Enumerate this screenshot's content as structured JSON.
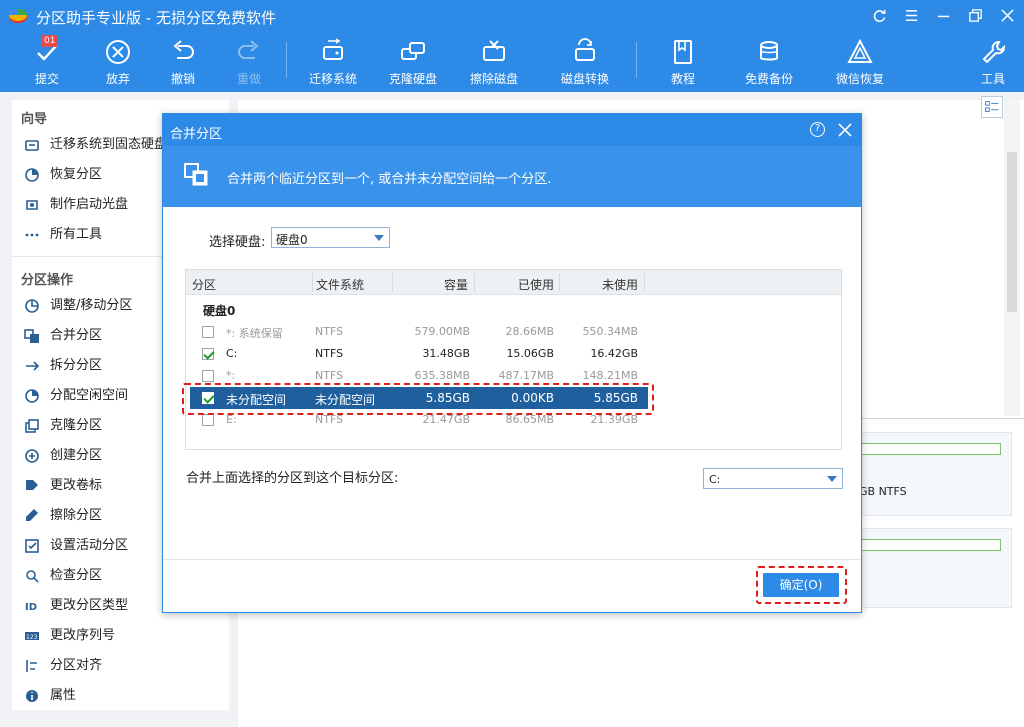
{
  "app": {
    "title": "分区助手专业版 - 无损分区免费软件"
  },
  "toolbar": {
    "badge": "01",
    "submit": "提交",
    "discard": "放弃",
    "undo": "撤销",
    "redo": "重做",
    "migrate": "迁移系统",
    "clone": "克隆硬盘",
    "wipe": "擦除磁盘",
    "convert": "磁盘转换",
    "tutorial": "教程",
    "backup": "免费备份",
    "wechat": "微信恢复",
    "tools": "工具"
  },
  "sidebar": {
    "wizard_title": "向导",
    "wizard_items": [
      {
        "label": "迁移系统到固态硬盘",
        "icon": "migrate-os-icon"
      },
      {
        "label": "恢复分区",
        "icon": "recover-partition-icon"
      },
      {
        "label": "制作启动光盘",
        "icon": "bootable-media-icon"
      },
      {
        "label": "所有工具",
        "icon": "more-dots-icon"
      }
    ],
    "ops_title": "分区操作",
    "ops_items": [
      {
        "label": "调整/移动分区",
        "icon": "resize-partition-icon"
      },
      {
        "label": "合并分区",
        "icon": "merge-partition-icon"
      },
      {
        "label": "拆分分区",
        "icon": "split-partition-icon"
      },
      {
        "label": "分配空闲空间",
        "icon": "allocate-space-icon"
      },
      {
        "label": "克隆分区",
        "icon": "clone-partition-icon"
      },
      {
        "label": "创建分区",
        "icon": "create-partition-icon"
      },
      {
        "label": "更改卷标",
        "icon": "tag-icon"
      },
      {
        "label": "擦除分区",
        "icon": "wipe-partition-icon"
      },
      {
        "label": "设置活动分区",
        "icon": "set-active-icon"
      },
      {
        "label": "检查分区",
        "icon": "check-partition-icon"
      },
      {
        "label": "更改分区类型",
        "icon": "id-icon"
      },
      {
        "label": "更改序列号",
        "icon": "serial-icon"
      },
      {
        "label": "分区对齐",
        "icon": "align-icon"
      },
      {
        "label": "属性",
        "icon": "info-icon"
      }
    ]
  },
  "background": {
    "fs_text": "GB NTFS"
  },
  "dialog": {
    "title": "合并分区",
    "help": "?",
    "banner": "合并两个临近分区到一个, 或合并未分配空间给一个分区.",
    "select_disk_label": "选择硬盘:",
    "select_disk_value": "硬盘0",
    "columns": [
      "分区",
      "文件系统",
      "容量",
      "已使用",
      "未使用"
    ],
    "disk_label": "硬盘0",
    "rows": [
      {
        "name": "*: 系统保留",
        "fs": "NTFS",
        "cap": "579.00MB",
        "used": "28.66MB",
        "free": "550.34MB",
        "checked": false,
        "enabled": false
      },
      {
        "name": "C:",
        "fs": "NTFS",
        "cap": "31.48GB",
        "used": "15.06GB",
        "free": "16.42GB",
        "checked": true,
        "enabled": true
      },
      {
        "name": "*:",
        "fs": "NTFS",
        "cap": "635.38MB",
        "used": "487.17MB",
        "free": "148.21MB",
        "checked": false,
        "enabled": false
      },
      {
        "name": "未分配空间",
        "fs": "未分配空间",
        "cap": "5.85GB",
        "used": "0.00KB",
        "free": "5.85GB",
        "checked": true,
        "enabled": true
      },
      {
        "name": "E:",
        "fs": "NTFS",
        "cap": "21.47GB",
        "used": "86.65MB",
        "free": "21.39GB",
        "checked": false,
        "enabled": false
      }
    ],
    "merge_label": "合并上面选择的分区到这个目标分区:",
    "target_value": "C:",
    "ok": "确定(O)"
  }
}
